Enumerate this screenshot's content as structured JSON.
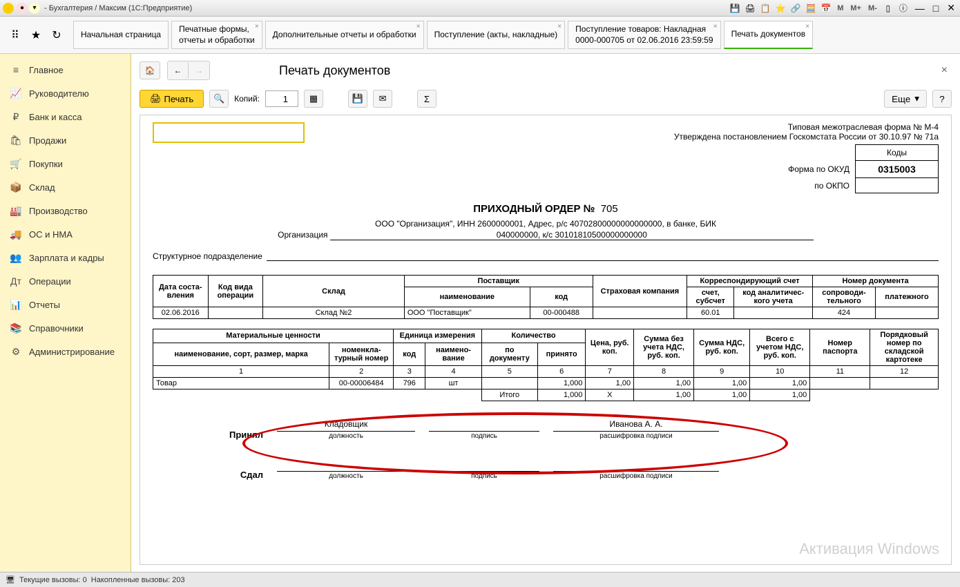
{
  "titlebar": {
    "title": "- Бухгалтерия / Максим  (1С:Предприятие)"
  },
  "memory_btns": [
    "M",
    "M+",
    "M-"
  ],
  "tabs": [
    {
      "label": "Начальная страница",
      "closable": false
    },
    {
      "label": "Печатные формы,\nотчеты и обработки",
      "closable": true
    },
    {
      "label": "Дополнительные отчеты и обработки",
      "closable": true
    },
    {
      "label": "Поступление (акты, накладные)",
      "closable": true
    },
    {
      "label": "Поступление товаров: Накладная\n0000-000705 от 02.06.2016 23:59:59",
      "closable": true
    },
    {
      "label": "Печать документов",
      "closable": true,
      "active": true
    }
  ],
  "sidebar": [
    {
      "icon": "≡",
      "label": "Главное"
    },
    {
      "icon": "📈",
      "label": "Руководителю"
    },
    {
      "icon": "₽",
      "label": "Банк и касса"
    },
    {
      "icon": "🛍",
      "label": "Продажи"
    },
    {
      "icon": "🛒",
      "label": "Покупки"
    },
    {
      "icon": "📦",
      "label": "Склад"
    },
    {
      "icon": "🏭",
      "label": "Производство"
    },
    {
      "icon": "🚚",
      "label": "ОС и НМА"
    },
    {
      "icon": "👥",
      "label": "Зарплата и кадры"
    },
    {
      "icon": "Дт",
      "label": "Операции"
    },
    {
      "icon": "📊",
      "label": "Отчеты"
    },
    {
      "icon": "📚",
      "label": "Справочники"
    },
    {
      "icon": "⚙",
      "label": "Администрирование"
    }
  ],
  "page": {
    "title": "Печать документов",
    "print_btn": "Печать",
    "copies_lbl": "Копий:",
    "copies_val": "1",
    "more_btn": "Еще",
    "help_btn": "?"
  },
  "doc": {
    "form_note1": "Типовая межотраслевая форма № М-4",
    "form_note2": "Утверждена постановлением Госкомстата России от 30.10.97 № 71а",
    "codes_hdr": "Коды",
    "okud_lbl": "Форма по ОКУД",
    "okud_val": "0315003",
    "okpo_lbl": "по ОКПО",
    "okpo_val": "",
    "title": "ПРИХОДНЫЙ ОРДЕР №",
    "number": "705",
    "org_line1": "ООО \"Организация\", ИНН 2600000001, Адрес, р/с 40702800000000000000, в банке, БИК",
    "org_lbl": "Организация",
    "org_line2": "040000000, к/с 30101810500000000000",
    "struct_lbl": "Структурное подразделение",
    "h": {
      "date": "Дата соста-\nвления",
      "opcode": "Код вида операции",
      "warehouse": "Склад",
      "supplier": "Поставщик",
      "supplier_name": "наименование",
      "supplier_code": "код",
      "insurance": "Страховая компания",
      "corr": "Корреспондирующий счет",
      "acct": "счет, субсчет",
      "analytics": "код аналитичес-\nкого учета",
      "docnum": "Номер документа",
      "accomp": "сопроводи-\nтельного",
      "payment": "платежного"
    },
    "row1": {
      "date": "02.06.2016",
      "opcode": "",
      "warehouse": "Склад №2",
      "supplier_name": "ООО \"Поставщик\"",
      "supplier_code": "00-000488",
      "insurance": "",
      "acct": "60.01",
      "analytics": "",
      "accomp": "424",
      "payment": ""
    },
    "h2": {
      "mat": "Материальные ценности",
      "mat_name": "наименование, сорт, размер, марка",
      "mat_code": "номенкла-\nтурный номер",
      "unit": "Единица измерения",
      "unit_code": "код",
      "unit_name": "наимено-\nвание",
      "qty": "Количество",
      "qty_doc": "по документу",
      "qty_acc": "принято",
      "price": "Цена, руб. коп.",
      "sum_novat": "Сумма без учета НДС, руб. коп.",
      "vat": "Сумма НДС, руб. коп.",
      "sum_vat": "Всего с учетом НДС, руб. коп.",
      "passport": "Номер паспорта",
      "card": "Порядковый номер по складской картотеке"
    },
    "colnums": [
      "1",
      "2",
      "3",
      "4",
      "5",
      "6",
      "7",
      "8",
      "9",
      "10",
      "11",
      "12"
    ],
    "item": {
      "name": "Товар",
      "code": "00-00006484",
      "unit_code": "796",
      "unit_name": "шт",
      "qty_doc": "",
      "qty_acc": "1,000",
      "price": "1,00",
      "sum_novat": "1,00",
      "vat": "1,00",
      "sum_vat": "1,00",
      "passport": "",
      "card": ""
    },
    "total_lbl": "Итого",
    "total": {
      "qty_acc": "1,000",
      "price": "X",
      "sum_novat": "1,00",
      "vat": "1,00",
      "sum_vat": "1,00"
    },
    "sig": {
      "accepted": "Принял",
      "gave": "Сдал",
      "position": "должность",
      "signature": "подпись",
      "fullname": "расшифровка подписи",
      "acc_pos": "Кладовщик",
      "acc_name": "Иванова А. А."
    }
  },
  "status": {
    "current": "Текущие вызовы: 0",
    "accum": "Накопленные вызовы: 203"
  },
  "watermark": "Активация Windows"
}
